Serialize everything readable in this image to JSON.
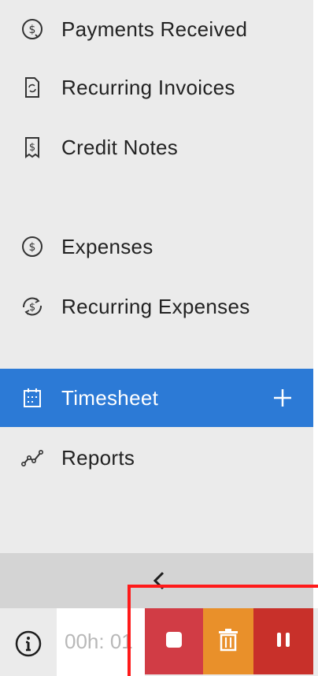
{
  "sidebar": {
    "items": [
      {
        "label": "Payments Received",
        "icon": "dollar-circle-arrow-icon"
      },
      {
        "label": "Recurring Invoices",
        "icon": "document-recurring-icon"
      },
      {
        "label": "Credit Notes",
        "icon": "document-dollar-icon"
      },
      {
        "label": "Expenses",
        "icon": "dollar-circle-icon"
      },
      {
        "label": "Recurring Expenses",
        "icon": "dollar-recurring-icon"
      },
      {
        "label": "Timesheet",
        "icon": "calendar-icon",
        "active": true,
        "action_icon": "plus-icon"
      },
      {
        "label": "Reports",
        "icon": "line-chart-icon"
      }
    ],
    "collapse_icon": "chevron-left-icon"
  },
  "timer": {
    "info_icon": "info-icon",
    "display": "00h: 01",
    "controls": [
      {
        "name": "stop",
        "icon": "stop-icon",
        "color": "#d13c45"
      },
      {
        "name": "delete",
        "icon": "trash-icon",
        "color": "#e9902a"
      },
      {
        "name": "pause",
        "icon": "pause-icon",
        "color": "#c8302a"
      }
    ]
  },
  "colors": {
    "sidebar_bg": "#ebebeb",
    "active_bg": "#2c7ad6",
    "highlight_border": "#ff1a1a"
  }
}
